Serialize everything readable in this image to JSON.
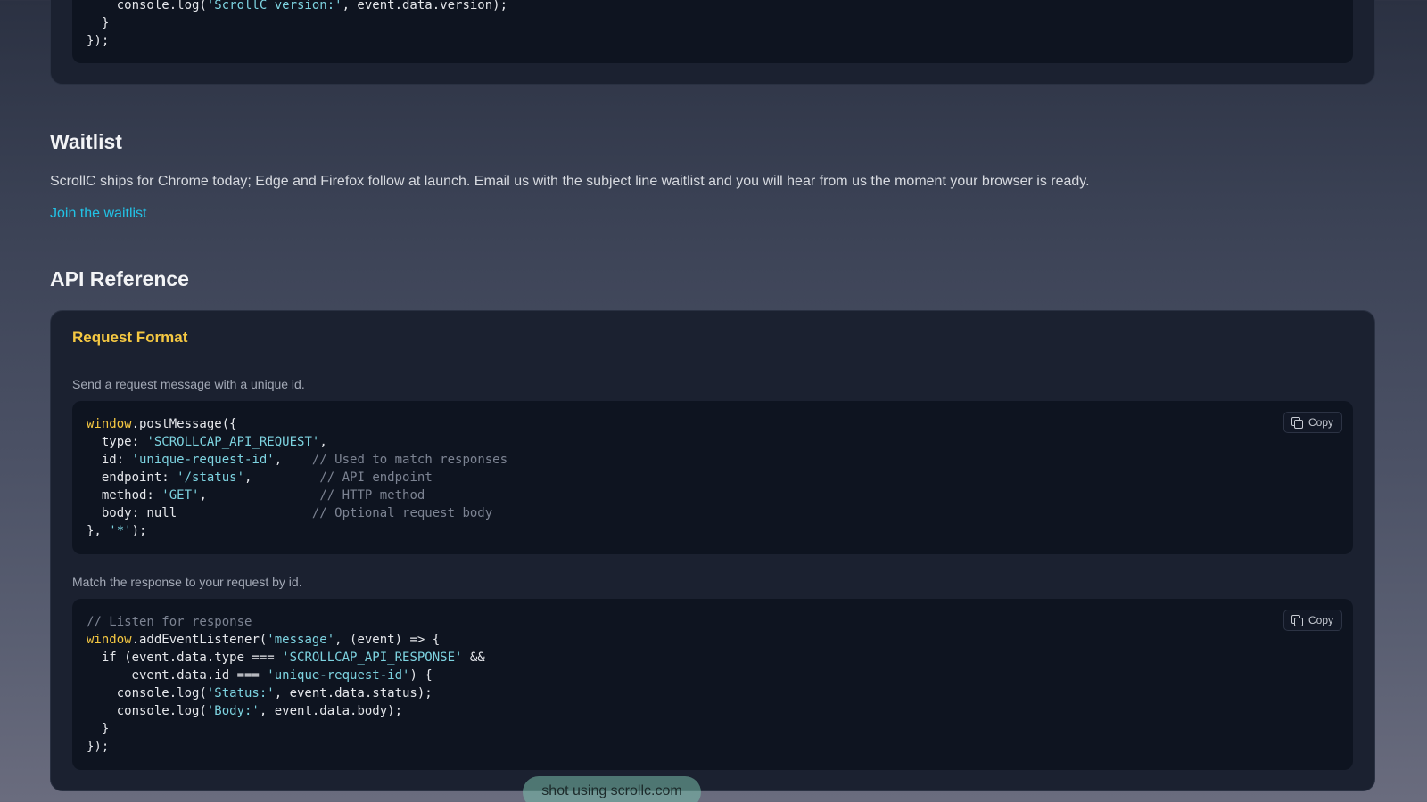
{
  "top_card": {
    "code_lines": [
      [
        {
          "t": "    console.log("
        },
        {
          "t": "'ScrollC version:'",
          "c": "str"
        },
        {
          "t": ", event.data.version);"
        }
      ],
      [
        {
          "t": "  }"
        }
      ],
      [
        {
          "t": "});"
        }
      ]
    ]
  },
  "waitlist": {
    "title": "Waitlist",
    "text": "ScrollC ships for Chrome today; Edge and Firefox follow at launch. Email us with the subject line waitlist and you will hear from us the moment your browser is ready.",
    "link_label": "Join the waitlist"
  },
  "api_reference": {
    "title": "API Reference",
    "request_format": {
      "heading": "Request Format",
      "request_caption": "Send a request message with a unique id.",
      "response_caption": "Match the response to your request by id.",
      "copy_label": "Copy",
      "request_code": [
        [
          {
            "t": "window",
            "c": "kw-y"
          },
          {
            "t": ".postMessage({"
          }
        ],
        [
          {
            "t": "  type: "
          },
          {
            "t": "'SCROLLCAP_API_REQUEST'",
            "c": "str"
          },
          {
            "t": ","
          }
        ],
        [
          {
            "t": "  id: "
          },
          {
            "t": "'unique-request-id'",
            "c": "str"
          },
          {
            "t": ",    "
          },
          {
            "t": "// Used to match responses",
            "c": "cmt"
          }
        ],
        [
          {
            "t": "  endpoint: "
          },
          {
            "t": "'/status'",
            "c": "str"
          },
          {
            "t": ",         "
          },
          {
            "t": "// API endpoint",
            "c": "cmt"
          }
        ],
        [
          {
            "t": "  method: "
          },
          {
            "t": "'GET'",
            "c": "str"
          },
          {
            "t": ",               "
          },
          {
            "t": "// HTTP method",
            "c": "cmt"
          }
        ],
        [
          {
            "t": "  body: null                  "
          },
          {
            "t": "// Optional request body",
            "c": "cmt"
          }
        ],
        [
          {
            "t": "}, "
          },
          {
            "t": "'*'",
            "c": "str"
          },
          {
            "t": ");"
          }
        ]
      ],
      "response_code": [
        [
          {
            "t": "// Listen for response",
            "c": "cmt"
          }
        ],
        [
          {
            "t": "window",
            "c": "kw-y"
          },
          {
            "t": ".addEventListener("
          },
          {
            "t": "'message'",
            "c": "str"
          },
          {
            "t": ", (event) => {"
          }
        ],
        [
          {
            "t": "  if (event.data.type === "
          },
          {
            "t": "'SCROLLCAP_API_RESPONSE'",
            "c": "str"
          },
          {
            "t": " &&"
          }
        ],
        [
          {
            "t": "      event.data.id === "
          },
          {
            "t": "'unique-request-id'",
            "c": "str"
          },
          {
            "t": ") {"
          }
        ],
        [
          {
            "t": "    console.log("
          },
          {
            "t": "'Status:'",
            "c": "str"
          },
          {
            "t": ", event.data.status);"
          }
        ],
        [
          {
            "t": "    console.log("
          },
          {
            "t": "'Body:'",
            "c": "str"
          },
          {
            "t": ", event.data.body);"
          }
        ],
        [
          {
            "t": "  }"
          }
        ],
        [
          {
            "t": "});"
          }
        ]
      ]
    }
  },
  "watermark": "shot using scrollc.com"
}
